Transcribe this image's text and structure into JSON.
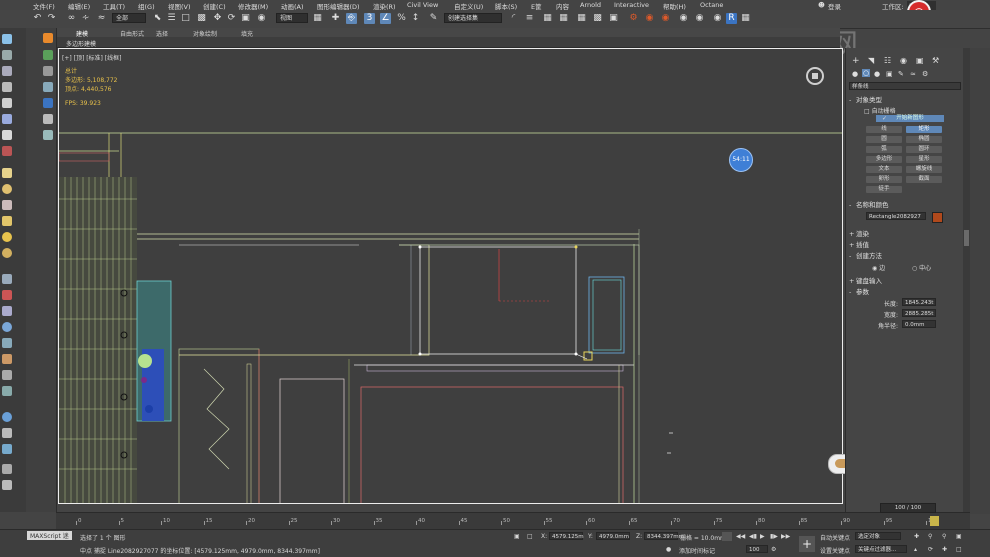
{
  "menu": {
    "items": [
      "文件(F)",
      "编辑(E)",
      "工具(T)",
      "组(G)",
      "视图(V)",
      "创建(C)",
      "修改器(M)",
      "动画(A)",
      "图形编辑器(D)",
      "渲染(R)",
      "Civil View",
      "自定义(U)",
      "脚本(S)",
      "E筐",
      "内容",
      "Arnold",
      "Interactive",
      "帮助(H)",
      "Octane"
    ],
    "user": "登录",
    "workspace_label": "工作区:",
    "workspace_value": "默认"
  },
  "toolbar": {
    "selection_filter": "全部",
    "view_dropdown": "视图",
    "snap_label": "3",
    "selection_set_placeholder": "创建选择集"
  },
  "ribbon": {
    "tabs": [
      "建模",
      "自由形式",
      "选择",
      "对象绘制",
      "填充"
    ],
    "sub_label": "多边形建模"
  },
  "viewport": {
    "label": "[+] [顶] [标准] [线框]",
    "stats_title": "总计",
    "stats_polys_label": "多边形:",
    "stats_polys": "5,108,772",
    "stats_verts_label": "顶点:",
    "stats_verts": "4,440,576",
    "fps_label": "FPS:",
    "fps_value": "39.923",
    "badge_time": "54:11",
    "gizmo_letter": "A"
  },
  "command_panel": {
    "category_dropdown": "样条线",
    "object_type_header": "对象类型",
    "autogrid_label": "自动栅格",
    "start_new_shape": "开始新图形",
    "buttons": [
      {
        "label": "线",
        "active": false
      },
      {
        "label": "矩形",
        "active": true
      },
      {
        "label": "圆",
        "active": false
      },
      {
        "label": "椭圆",
        "active": false
      },
      {
        "label": "弧",
        "active": false
      },
      {
        "label": "圆环",
        "active": false
      },
      {
        "label": "多边形",
        "active": false
      },
      {
        "label": "星形",
        "active": false
      },
      {
        "label": "文本",
        "active": false
      },
      {
        "label": "螺旋线",
        "active": false
      },
      {
        "label": "卵形",
        "active": false
      },
      {
        "label": "截面",
        "active": false
      },
      {
        "label": "徒手",
        "active": false
      }
    ],
    "name_color_header": "名称和颜色",
    "object_name": "Rectangle2082927",
    "object_color": "#b0491c",
    "render_header": "渲染",
    "interp_header": "插值",
    "creation_header": "创建方法",
    "creation_options": [
      "边",
      "中心"
    ],
    "keyboard_header": "键盘输入",
    "params_header": "参数",
    "length_label": "长度:",
    "length_value": "1845.243t",
    "width_label": "宽度:",
    "width_value": "2885.285t",
    "corner_label": "角半径:",
    "corner_value": "0.0mm"
  },
  "timeline": {
    "counter": "100 / 100",
    "ticks": [
      "0",
      "5",
      "10",
      "15",
      "20",
      "25",
      "30",
      "35",
      "40",
      "45",
      "50",
      "55",
      "60",
      "65",
      "70",
      "75",
      "80",
      "85",
      "90",
      "95",
      "100"
    ]
  },
  "status": {
    "script_label": "MAXScript 迷",
    "selected_text": "选择了 1 个 图形",
    "hint_text": "中点 捕捉 Line2082927077 的坐标位置: [4579.125mm, 4979.0mm, 8344.397mm]",
    "x_label": "X:",
    "x_value": "4579.125m",
    "y_label": "Y:",
    "y_value": "4979.0mm",
    "z_label": "Z:",
    "z_value": "8344.397mm",
    "grid_label": "栅格 = 10.0mm",
    "add_time_tag": "添加时间标记",
    "auto_key": "自动关键点",
    "set_key": "设置关键点",
    "selected_object": "选定对象",
    "key_filter": "关键点过滤器...",
    "frame_value": "100"
  },
  "watermark_text": "虎课网",
  "colors": {
    "accent": "#5f88b8",
    "badge": "#3f7fd6",
    "stats_text": "#e8c14a",
    "record": "#d62b2b"
  }
}
